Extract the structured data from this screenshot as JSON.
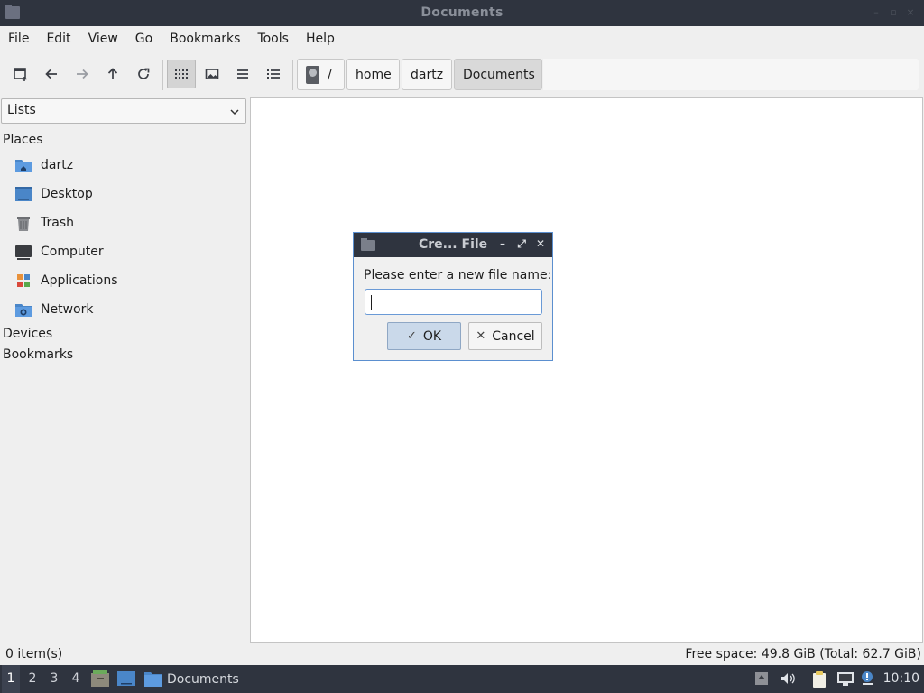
{
  "window": {
    "title": "Documents"
  },
  "menu": [
    "File",
    "Edit",
    "View",
    "Go",
    "Bookmarks",
    "Tools",
    "Help"
  ],
  "toolbar": {
    "buttons": [
      "new-tab-icon",
      "back-arrow-icon",
      "forward-arrow-icon",
      "up-arrow-icon",
      "reload-icon",
      "icon-view-icon",
      "thumbnail-view-icon",
      "compact-view-icon",
      "detailed-list-icon"
    ],
    "active_view": "icon-view"
  },
  "path": {
    "root": "/",
    "segments": [
      "home",
      "dartz",
      "Documents"
    ],
    "current": "Documents"
  },
  "sidebar": {
    "mode": "Lists",
    "places_header": "Places",
    "places": [
      {
        "label": "dartz",
        "icon": "home-folder-icon"
      },
      {
        "label": "Desktop",
        "icon": "desktop-icon"
      },
      {
        "label": "Trash",
        "icon": "trash-icon"
      },
      {
        "label": "Computer",
        "icon": "computer-icon"
      },
      {
        "label": "Applications",
        "icon": "applications-icon"
      },
      {
        "label": "Network",
        "icon": "network-folder-icon"
      }
    ],
    "devices_header": "Devices",
    "bookmarks_header": "Bookmarks"
  },
  "status": {
    "items": "0 item(s)",
    "free_space": "Free space: 49.8 GiB (Total: 62.7 GiB)"
  },
  "dialog": {
    "title": "Cre... File",
    "prompt": "Please enter a new file name:",
    "value": "",
    "ok": "OK",
    "cancel": "Cancel"
  },
  "taskbar": {
    "workspaces": [
      "1",
      "2",
      "3",
      "4"
    ],
    "active_workspace": "1",
    "task_label": "Documents",
    "clock": "10:10"
  },
  "colors": {
    "titlebar": "#2f343f",
    "accent": "#5b8fcf",
    "ok_button": "#cad9ea"
  }
}
